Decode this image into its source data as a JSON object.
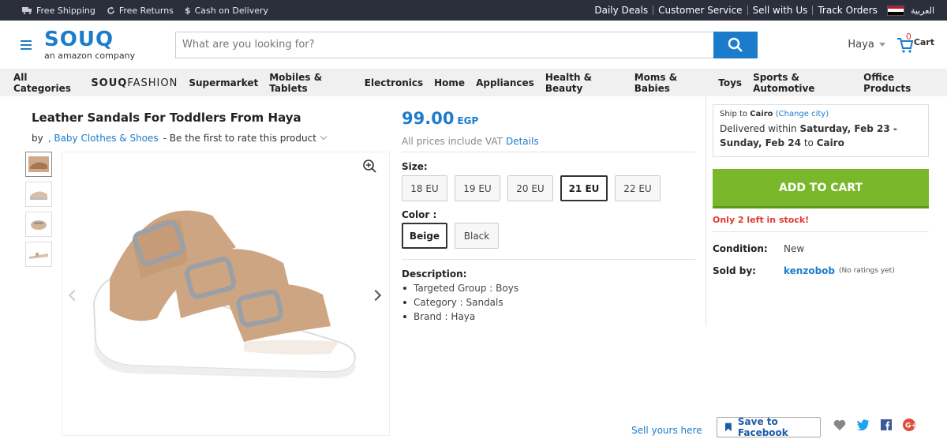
{
  "topbar": {
    "left": [
      "Free Shipping",
      "Free Returns",
      "Cash on Delivery"
    ],
    "right": [
      "Daily Deals",
      "Customer Service",
      "Sell with Us",
      "Track Orders"
    ],
    "lang": "العربية"
  },
  "header": {
    "logo": "SOUQ",
    "logo_sub": "an amazon company",
    "search_placeholder": "What are you looking for?",
    "user": "Haya",
    "cart_label": "Cart",
    "cart_count": "0"
  },
  "nav": {
    "items": [
      "All Categories",
      "Supermarket",
      "Mobiles & Tablets",
      "Electronics",
      "Home",
      "Appliances",
      "Health & Beauty",
      "Moms & Babies",
      "Toys",
      "Sports & Automotive",
      "Office Products"
    ],
    "fashion_a": "SOUQ",
    "fashion_b": "FASHION"
  },
  "product": {
    "title": "Leather Sandals For Toddlers From Haya",
    "by": "by",
    "category": ", Baby Clothes & Shoes",
    "rate": "- Be the first to rate this product",
    "price": "99.00",
    "currency": "EGP",
    "vat": "All prices include VAT",
    "vat_link": "Details",
    "size_label": "Size:",
    "sizes": [
      "18 EU",
      "19 EU",
      "20 EU",
      "21 EU",
      "22 EU"
    ],
    "selected_size": "21 EU",
    "color_label": "Color :",
    "colors": [
      "Beige",
      "Black"
    ],
    "selected_color": "Beige",
    "desc_label": "Description:",
    "desc": [
      "Targeted Group : Boys",
      "Category : Sandals",
      "Brand : Haya"
    ]
  },
  "sidebar": {
    "ship_to": "Ship to",
    "city": "Cairo",
    "change": "(Change city)",
    "delivered": "Delivered within",
    "dates": "Saturday, Feb 23 - Sunday, Feb 24",
    "to": "to",
    "to_city": "Cairo",
    "add_to_cart": "ADD TO CART",
    "stock": "Only 2 left in stock!",
    "condition_label": "Condition:",
    "condition": "New",
    "sold_label": "Sold by:",
    "seller": "kenzobob",
    "ratings": "(No ratings yet)"
  },
  "bottom": {
    "sell_yours": "Sell yours here",
    "save_fb": "Save to Facebook"
  }
}
